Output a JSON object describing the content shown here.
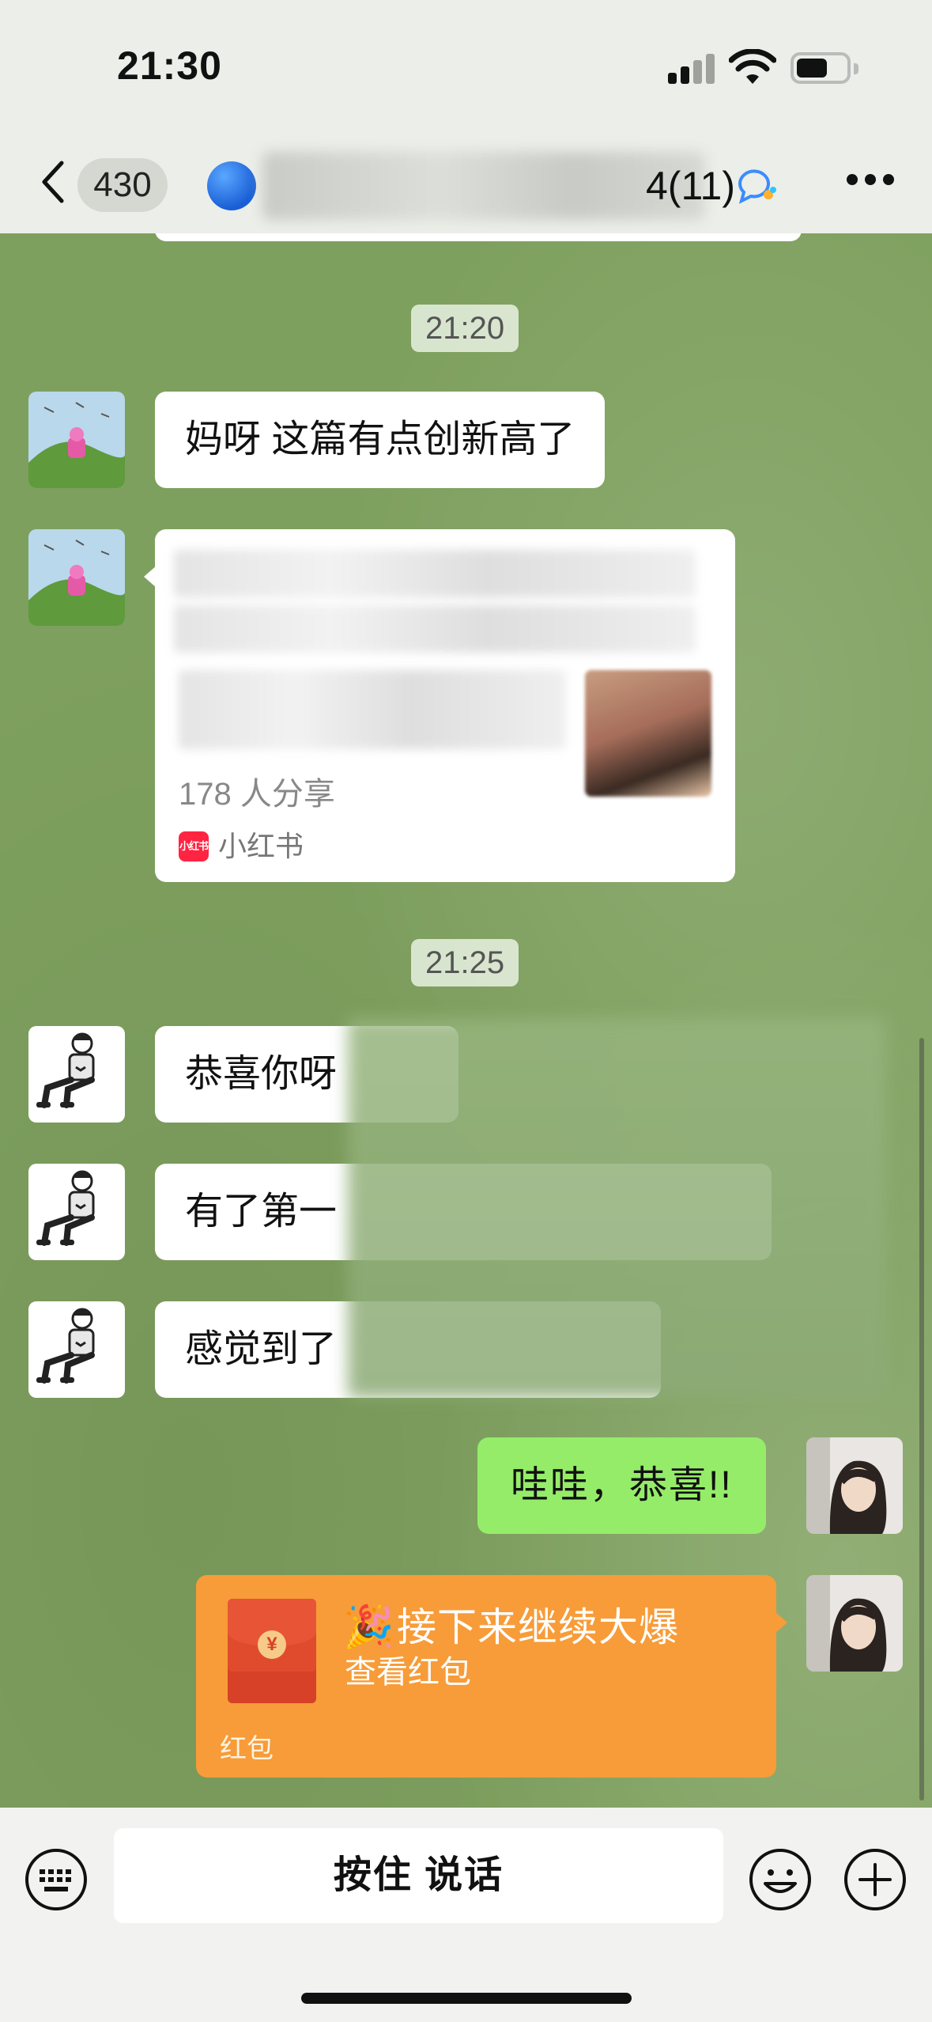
{
  "status_bar": {
    "time": "21:30"
  },
  "nav": {
    "unread_count": "430",
    "title_suffix": "4(11)"
  },
  "messages": {
    "timestamp_1": "21:20",
    "msg_1": "妈呀 这篇有点创新高了",
    "link_card": {
      "shares": "178 人分享",
      "source": "小红书",
      "source_logo": "小红书"
    },
    "timestamp_2": "21:25",
    "msg_2": "恭喜你呀",
    "msg_3": "有了第一",
    "msg_4": "感觉到了",
    "msg_mine": "哇哇，恭喜!!",
    "red_packet": {
      "emoji": "🎉",
      "title": "接下来继续大爆",
      "subtitle": "查看红包",
      "label": "红包",
      "coin_symbol": "¥"
    }
  },
  "input_bar": {
    "voice_label": "按住 说话"
  },
  "colors": {
    "chat_bg": "#7ea05e",
    "my_bubble": "#95ec69",
    "red_packet": "#f79c39",
    "xhs_red": "#ff2442"
  }
}
